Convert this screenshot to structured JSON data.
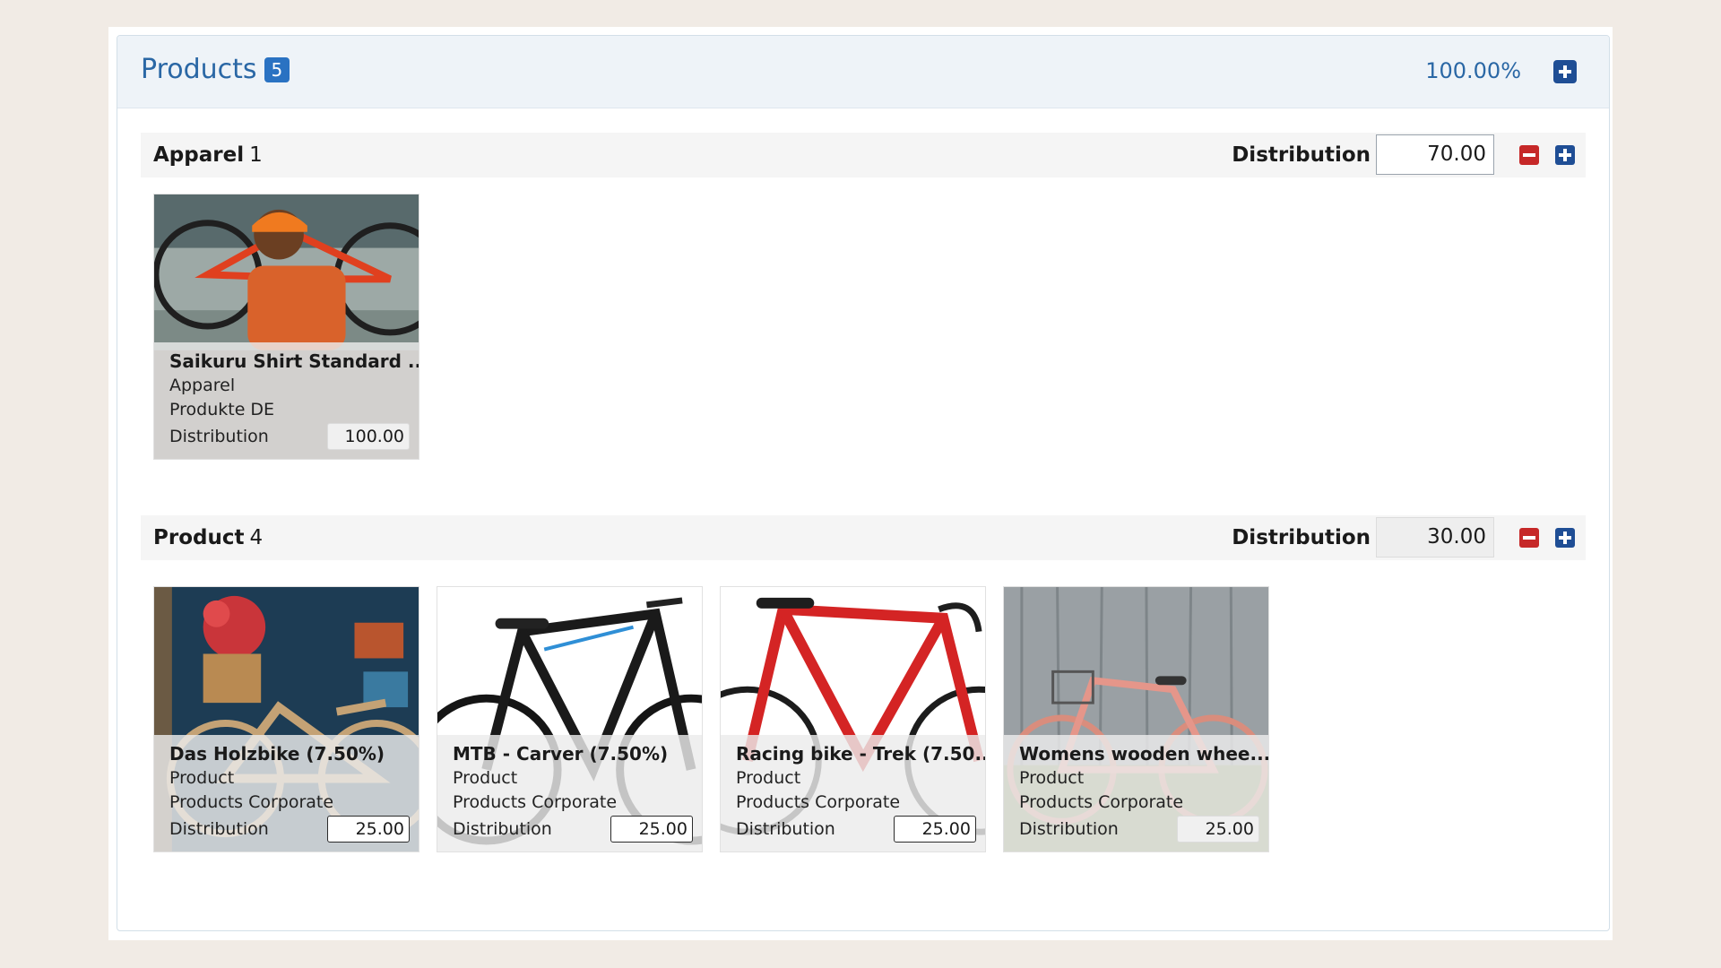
{
  "header": {
    "title": "Products",
    "badge": "5",
    "total_percent": "100.00%"
  },
  "groups": [
    {
      "name": "Apparel",
      "count": "1",
      "distribution_label": "Distribution",
      "distribution_value": "70.00",
      "items": [
        {
          "name": "Saikuru Shirt Standard ...",
          "category": "Apparel",
          "catalog": "Produkte DE",
          "distribution_label": "Distribution",
          "distribution_value": "100.00"
        }
      ]
    },
    {
      "name": "Product",
      "count": "4",
      "distribution_label": "Distribution",
      "distribution_value": "30.00",
      "items": [
        {
          "name": "Das Holzbike (7.50%)",
          "category": "Product",
          "catalog": "Products Corporate",
          "distribution_label": "Distribution",
          "distribution_value": "25.00"
        },
        {
          "name": "MTB - Carver (7.50%)",
          "category": "Product",
          "catalog": "Products Corporate",
          "distribution_label": "Distribution",
          "distribution_value": "25.00"
        },
        {
          "name": "Racing bike - Trek (7.50...",
          "category": "Product",
          "catalog": "Products Corporate",
          "distribution_label": "Distribution",
          "distribution_value": "25.00"
        },
        {
          "name": "Womens wooden whee...",
          "category": "Product",
          "catalog": "Products Corporate",
          "distribution_label": "Distribution",
          "distribution_value": "25.00"
        }
      ]
    }
  ],
  "colors": {
    "accent": "#2a67a5",
    "badge": "#2a72c2",
    "add_button": "#1f4e95",
    "remove_button": "#c62828",
    "page_background": "#f1ebe5"
  },
  "icons": {
    "add": "plus-square-icon",
    "remove": "minus-square-icon"
  }
}
